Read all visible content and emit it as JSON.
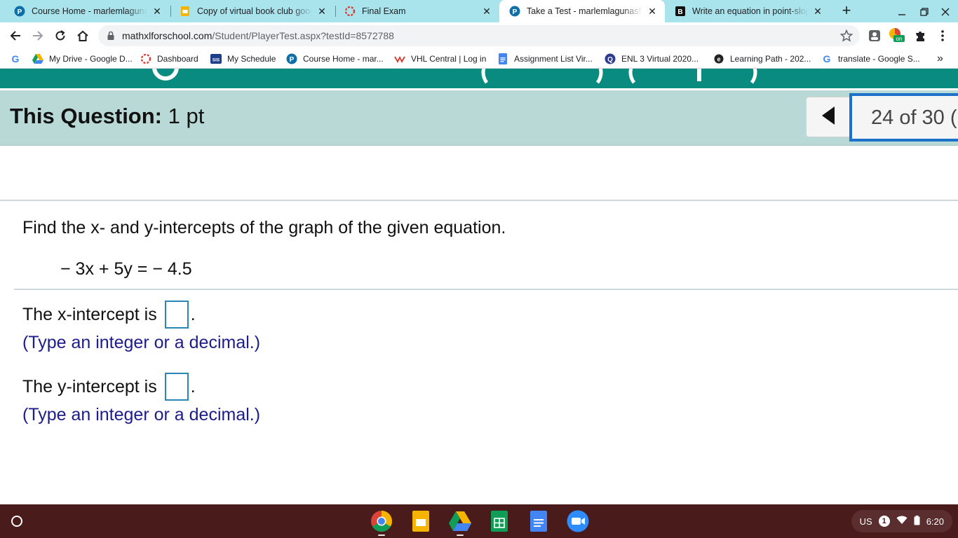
{
  "browser": {
    "tabs": [
      {
        "title": "Course Home - marlemlagunasflores",
        "icon": "pearson-icon"
      },
      {
        "title": "Copy of virtual book club google slides",
        "icon": "google-slides-icon"
      },
      {
        "title": "Final Exam",
        "icon": "dashed-circle-icon"
      },
      {
        "title": "Take a Test - marlemlagunasflores",
        "icon": "pearson-icon"
      },
      {
        "title": "Write an equation in point-slope form",
        "icon": "brainly-icon"
      }
    ],
    "active_tab_index": 3,
    "tab_close": "✕",
    "new_tab": "+",
    "url_domain": "mathxlforschool.com",
    "url_path": "/Student/PlayerTest.aspx?testId=8572788",
    "bookmarks": [
      {
        "label": "My Drive - Google D...",
        "icon": "google-drive-icon"
      },
      {
        "label": "Dashboard",
        "icon": "dashed-circle-icon"
      },
      {
        "label": "My Schedule",
        "icon": "sis-icon"
      },
      {
        "label": "Course Home - mar...",
        "icon": "pearson-icon"
      },
      {
        "label": "VHL Central | Log in",
        "icon": "vhl-icon"
      },
      {
        "label": "Assignment List Vir...",
        "icon": "google-docs-icon"
      },
      {
        "label": "ENL 3 Virtual 2020...",
        "icon": "quizlet-icon"
      },
      {
        "label": "Learning Path - 202...",
        "icon": "edgenuity-icon"
      },
      {
        "label": "translate - Google S...",
        "icon": "google-icon"
      }
    ],
    "bookmarks_overflow": "»",
    "sis_text": "SIS",
    "extension_badge": "on"
  },
  "question": {
    "points_label": "This Question:",
    "points_value": "1 pt",
    "counter": "24 of 30 (",
    "prompt": "Find the x- and y-intercepts of the graph of the given equation.",
    "equation": "− 3x + 5y =  − 4.5",
    "x_intercept_label": "The x-intercept is",
    "y_intercept_label": "The y-intercept is",
    "period": ".",
    "hint": "(Type an integer or a decimal.)"
  },
  "shelf": {
    "apps": [
      "chrome-icon",
      "google-slides-icon",
      "google-drive-icon",
      "google-sheets-icon",
      "google-docs-icon",
      "zoom-icon"
    ],
    "ime": "US",
    "notification_count": "1",
    "time": "6:20"
  },
  "colors": {
    "tabstrip": "#a9e3ec",
    "teal_band": "#0a8b7f",
    "question_bar": "#b9d9d6",
    "counter_border": "#1a73c8",
    "answer_box": "#2a86b7",
    "hint_text": "#1c1c8a",
    "shelf": "#4a1b1b"
  }
}
